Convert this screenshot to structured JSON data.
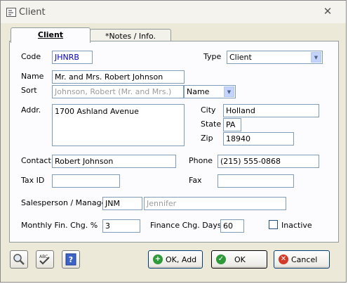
{
  "window": {
    "title": "Client"
  },
  "tabs": [
    {
      "label": "Client",
      "active": true
    },
    {
      "label": "*Notes / Info.",
      "active": false
    }
  ],
  "fields": {
    "code": {
      "label": "Code",
      "value": "JHNRB"
    },
    "type": {
      "label": "Type",
      "value": "Client"
    },
    "name": {
      "label": "Name",
      "value": "Mr. and Mrs. Robert Johnson"
    },
    "sort": {
      "label": "Sort",
      "value": "Johnson, Robert (Mr. and Mrs.)",
      "mode": "Name"
    },
    "addr": {
      "label": "Addr.",
      "value": "1700 Ashland Avenue"
    },
    "city": {
      "label": "City",
      "value": "Holland"
    },
    "state": {
      "label": "State",
      "value": "PA"
    },
    "zip": {
      "label": "Zip",
      "value": "18940"
    },
    "contact": {
      "label": "Contact",
      "value": "Robert Johnson"
    },
    "phone": {
      "label": "Phone",
      "value": "(215) 555-0868"
    },
    "tax_id": {
      "label": "Tax ID",
      "value": ""
    },
    "fax": {
      "label": "Fax",
      "value": ""
    },
    "salesperson": {
      "label": "Salesperson / Manager",
      "code": "JNM",
      "name": "Jennifer"
    },
    "monthly_fin_chg": {
      "label": "Monthly Fin. Chg. %",
      "value": "3"
    },
    "finance_chg_days": {
      "label": "Finance Chg. Days",
      "value": "60"
    },
    "inactive": {
      "label": "Inactive",
      "checked": false
    }
  },
  "buttons": {
    "ok_add": "OK, Add",
    "ok": "OK",
    "cancel": "Cancel"
  },
  "icons": {
    "search": "magnifier-icon",
    "spellcheck": "spellcheck-icon",
    "help": "help-icon"
  },
  "colors": {
    "ok_add_icon": "#2e9a3a",
    "ok_icon": "#2e9a3a",
    "cancel_icon": "#d23a2a",
    "code_text": "#0000c0"
  }
}
